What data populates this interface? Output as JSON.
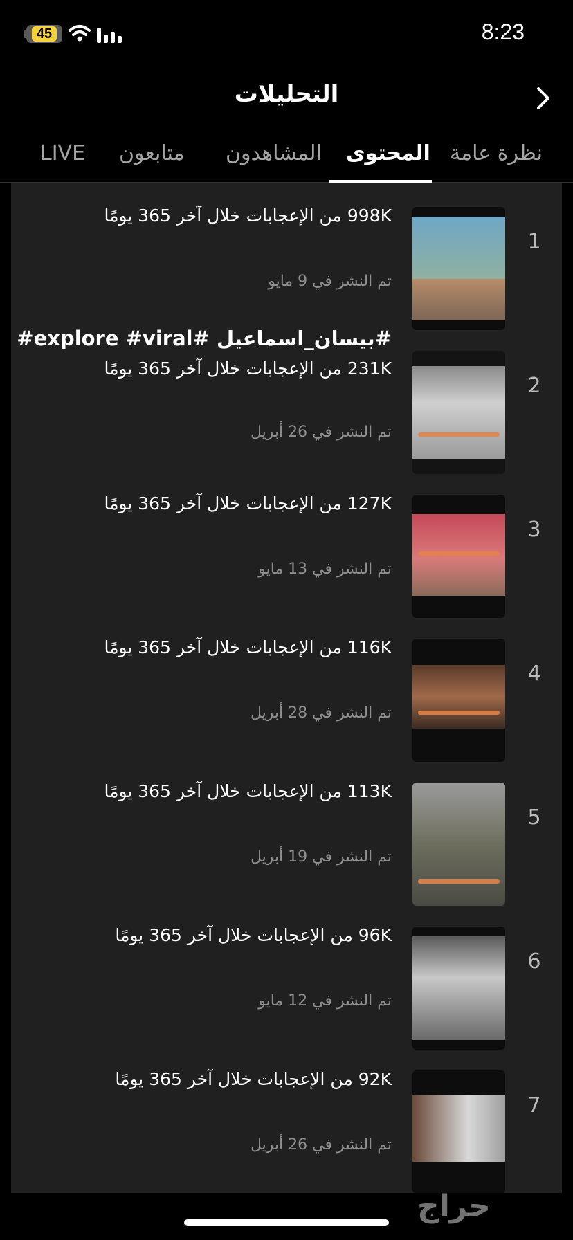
{
  "status_bar": {
    "battery": "45",
    "time": "8:23"
  },
  "header": {
    "title": "التحليلات"
  },
  "tabs": [
    {
      "label": "نظرة عامة",
      "active": false
    },
    {
      "label": "المحتوى",
      "active": true
    },
    {
      "label": "المشاهدون",
      "active": false
    },
    {
      "label": "متابعون",
      "active": false
    },
    {
      "label": "LIVE",
      "active": false
    }
  ],
  "videos": [
    {
      "rank": "1",
      "title": "",
      "likes": "998K من الإعجابات خلال آخر 365 يومًا",
      "date": "تم النشر في 9 مايو"
    },
    {
      "rank": "2",
      "title": "#بيسان_اسماعيل #fyp #explore #viral",
      "likes": "231K من الإعجابات خلال آخر 365 يومًا",
      "date": "تم النشر في 26 أبريل"
    },
    {
      "rank": "3",
      "title": "",
      "likes": "127K من الإعجابات خلال آخر 365 يومًا",
      "date": "تم النشر في 13 مايو"
    },
    {
      "rank": "4",
      "title": "",
      "likes": "116K من الإعجابات خلال آخر 365 يومًا",
      "date": "تم النشر في 28 أبريل"
    },
    {
      "rank": "5",
      "title": "",
      "likes": "113K من الإعجابات خلال آخر 365 يومًا",
      "date": "تم النشر في 19 أبريل"
    },
    {
      "rank": "6",
      "title": "",
      "likes": "96K من الإعجابات خلال آخر 365 يومًا",
      "date": "تم النشر في 12 مايو"
    },
    {
      "rank": "7",
      "title": "",
      "likes": "92K من الإعجابات خلال آخر 365 يومًا",
      "date": "تم النشر في 26 أبريل"
    }
  ],
  "watermark": "حراج"
}
